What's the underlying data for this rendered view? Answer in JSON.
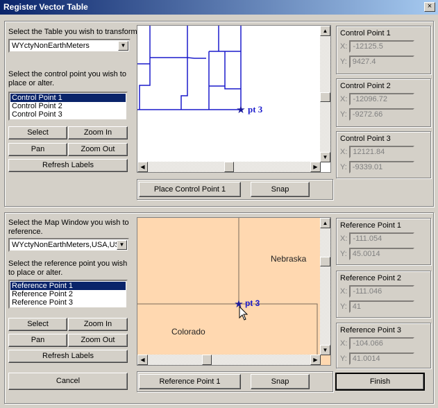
{
  "window": {
    "title": "Register Vector Table",
    "close": "×"
  },
  "top": {
    "table_prompt": "Select the Table you wish to transform.",
    "table_value": "WYctyNonEarthMeters",
    "point_prompt": "Select the control point you wish to place or alter.",
    "points": [
      "Control Point 1",
      "Control Point 2",
      "Control Point 3"
    ],
    "select": "Select",
    "zoom_in": "Zoom In",
    "pan": "Pan",
    "zoom_out": "Zoom Out",
    "refresh": "Refresh Labels",
    "map_label": "pt 3",
    "place": "Place Control Point 1",
    "snap": "Snap",
    "boxes": [
      {
        "title": "Control Point 1",
        "x": "-12125.5",
        "y": "9427.4"
      },
      {
        "title": "Control Point 2",
        "x": "-12096.72",
        "y": "-9272.66"
      },
      {
        "title": "Control Point 3",
        "x": "12121.84",
        "y": "-9339.01"
      }
    ]
  },
  "bottom": {
    "map_prompt": "Select the Map Window you wish to reference.",
    "map_value": "WYctyNonEarthMeters,USA,USA",
    "point_prompt": "Select the reference point you wish to place or alter.",
    "points": [
      "Reference Point 1",
      "Reference Point 2",
      "Reference Point 3"
    ],
    "select": "Select",
    "zoom_in": "Zoom In",
    "pan": "Pan",
    "zoom_out": "Zoom Out",
    "refresh": "Refresh Labels",
    "map_label": "pt 3",
    "state1": "Nebraska",
    "state2": "Colorado",
    "place": "Reference Point 1",
    "snap": "Snap",
    "boxes": [
      {
        "title": "Reference Point 1",
        "x": "-111.054",
        "y": "45.0014"
      },
      {
        "title": "Reference Point 2",
        "x": "-111.046",
        "y": "41"
      },
      {
        "title": "Reference Point 3",
        "x": "-104.066",
        "y": "41.0014"
      }
    ]
  },
  "labels": {
    "x": "X:",
    "y": "Y:"
  },
  "cancel": "Cancel",
  "finish": "Finish",
  "colors": {
    "title": "#0a246a",
    "map_lines": "#1a1acc",
    "ref_fill": "#ffd8b0"
  }
}
